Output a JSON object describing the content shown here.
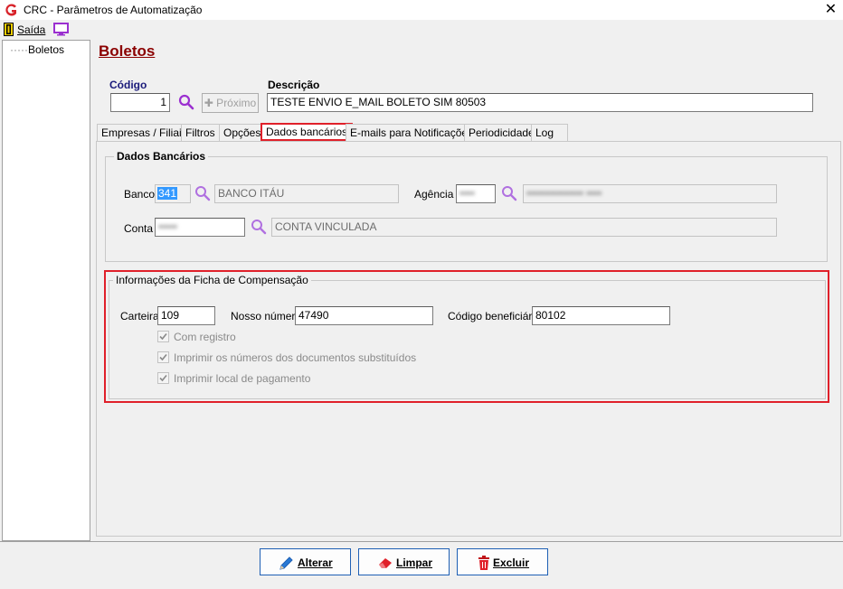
{
  "window": {
    "title": "CRC - Parâmetros de Automatização",
    "close_glyph": "✕"
  },
  "menubar": {
    "exit_label": "Saída"
  },
  "tree": {
    "prefix": "·····",
    "items": [
      "Boletos"
    ]
  },
  "page": {
    "heading": "Boletos"
  },
  "header": {
    "codigo_label": "Código",
    "codigo_value": "1",
    "next_button": "✚ Próximo",
    "descricao_label": "Descrição",
    "descricao_value": "TESTE ENVIO  E_MAIL BOLETO SIM 80503"
  },
  "tabs": [
    "Empresas / Filiais",
    "Filtros",
    "Opções",
    "Dados bancários",
    "E-mails para Notificações",
    "Periodicidade",
    "Log"
  ],
  "active_tab": "Dados bancários",
  "dados_bancarios": {
    "title": "Dados Bancários",
    "banco_label": "Banco",
    "banco_code": "341",
    "banco_name": "BANCO ITÁU",
    "agencia_label": "Agência",
    "agencia_code": "••••",
    "agencia_name": "••••••••••••••• ••••",
    "conta_label": "Conta",
    "conta_code": "•••••",
    "conta_name": "CONTA VINCULADA"
  },
  "ficha": {
    "title": "Informações da Ficha de Compensação",
    "carteira_label": "Carteira",
    "carteira_value": "109",
    "nosso_numero_label": "Nosso número",
    "nosso_numero_value": "47490",
    "codigo_beneficiario_label": "Código beneficiário",
    "codigo_beneficiario_value": "80102",
    "checkboxes": [
      {
        "label": "Com registro",
        "checked": true
      },
      {
        "label": "Imprimir os números dos documentos substituídos",
        "checked": true
      },
      {
        "label": "Imprimir local de pagamento",
        "checked": true
      }
    ]
  },
  "actions": {
    "alterar": "Alterar",
    "limpar": "Limpar",
    "excluir": "Excluir"
  },
  "colors": {
    "accent_red": "#e0202a",
    "heading": "#8b0000",
    "label_blue": "#1a1a7a",
    "search_purple": "#9b30d0"
  }
}
